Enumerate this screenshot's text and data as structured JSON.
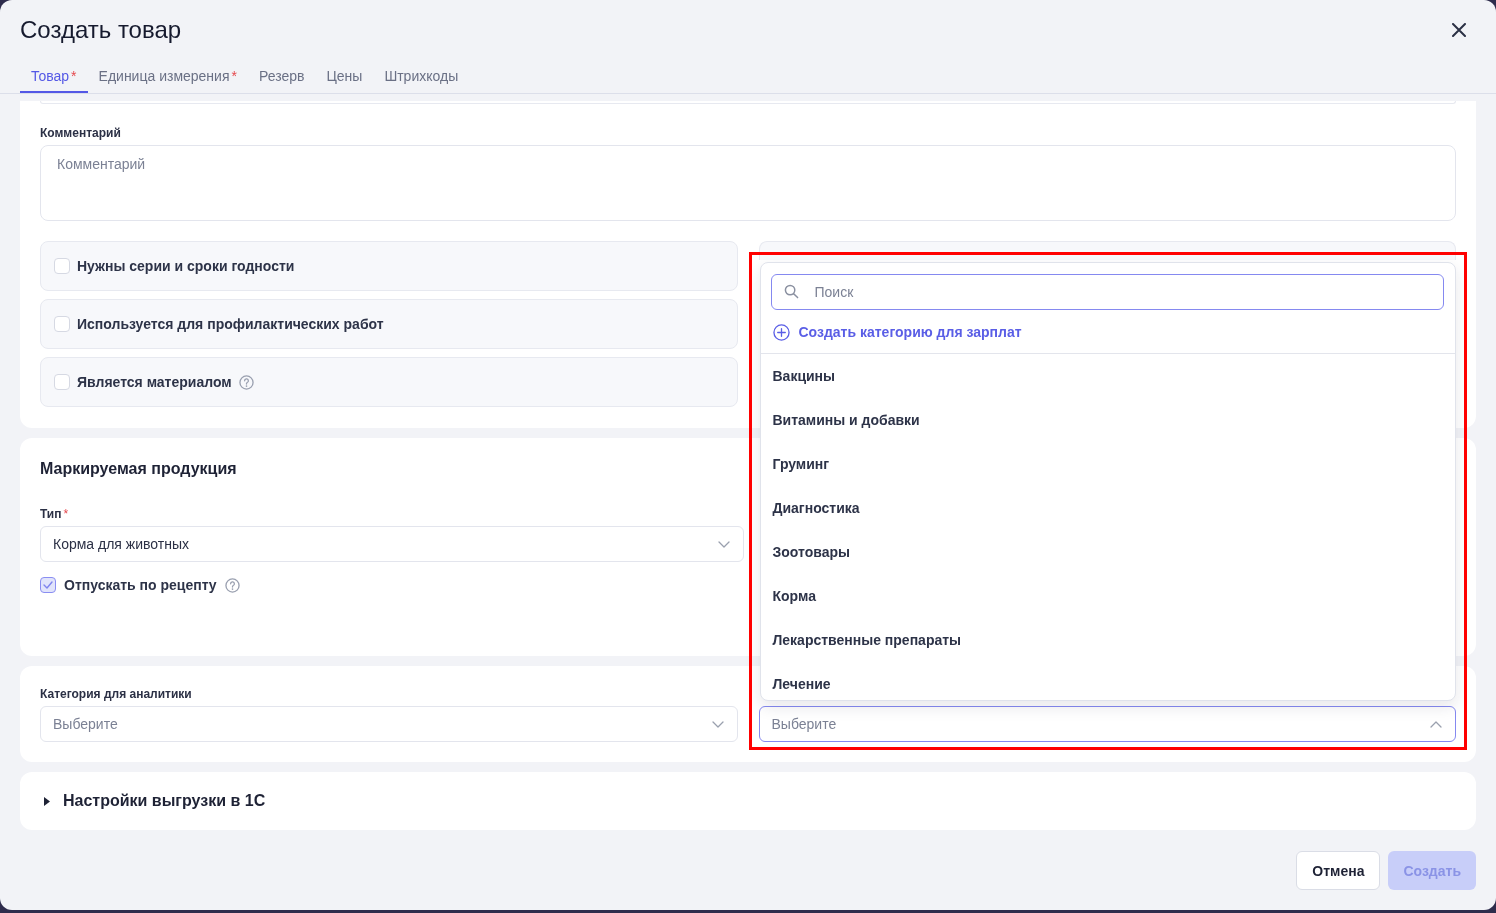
{
  "window": {
    "title": "Создать товар"
  },
  "tabs": [
    {
      "label": "Товар",
      "required_mark": "*",
      "selected": true
    },
    {
      "label": "Единица измерения",
      "required_mark": "*",
      "selected": false
    },
    {
      "label": "Резерв",
      "selected": false
    },
    {
      "label": "Цены",
      "selected": false
    },
    {
      "label": "Штрихкоды",
      "selected": false
    }
  ],
  "general": {
    "comment": {
      "label": "Комментарий",
      "placeholder": "Комментарий"
    },
    "options": [
      {
        "label": "Нужны серии и сроки годности",
        "checked": false,
        "help": false
      },
      {
        "label": "Используется для профилактических работ",
        "checked": false,
        "help": false
      },
      {
        "label": "Является материалом",
        "checked": false,
        "help": true
      }
    ]
  },
  "marking": {
    "title": "Маркируемая продукция",
    "type": {
      "label": "Тип",
      "required_mark": "*",
      "value": "Корма для животных",
      "expanded": false
    },
    "prescription": {
      "label": "Отпускать по рецепту",
      "checked": true,
      "help": true
    }
  },
  "analytics": {
    "category": {
      "label": "Категория для аналитики",
      "placeholder": "Выберите",
      "expanded": false
    },
    "second_select": {
      "placeholder": "Выберите",
      "expanded": true,
      "dropdown": {
        "search": {
          "placeholder": "Поиск"
        },
        "create_link": {
          "label": "Создать категорию для зарплат"
        },
        "options": [
          {
            "label": "Вакцины",
            "selected": false
          },
          {
            "label": "Витамины и добавки",
            "selected": false
          },
          {
            "label": "Груминг",
            "selected": false
          },
          {
            "label": "Диагностика",
            "selected": false
          },
          {
            "label": "Зоотовары",
            "selected": false
          },
          {
            "label": "Корма",
            "selected": false
          },
          {
            "label": "Лекарственные препараты",
            "selected": false
          },
          {
            "label": "Лечение",
            "selected": false
          }
        ]
      }
    }
  },
  "export": {
    "label": "Настройки выгрузки в 1С",
    "expanded": false
  },
  "footer": {
    "buttons": [
      {
        "label": "Отмена",
        "kind": "cancel",
        "disabled": false
      },
      {
        "label": "Создать",
        "kind": "submit",
        "disabled": true
      }
    ]
  },
  "annotation": {
    "kind": "frame"
  }
}
